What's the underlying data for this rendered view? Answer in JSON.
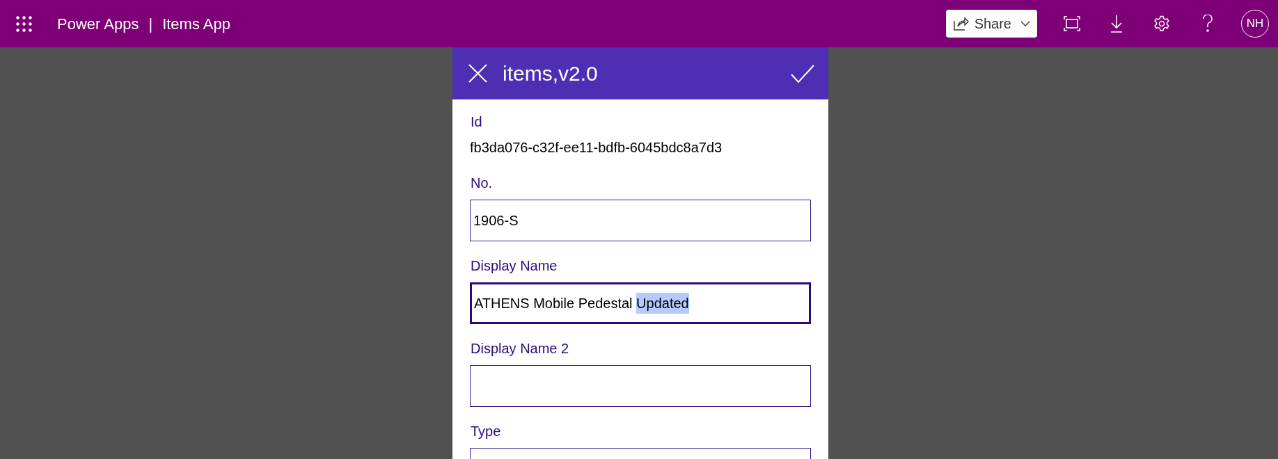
{
  "top_bar": {
    "app_name": "Power Apps",
    "separator": "|",
    "title": "Items App",
    "share_button": "Share",
    "avatar": "NH"
  },
  "form": {
    "title": "items,v2.0",
    "fields": [
      {
        "kind": "readonly",
        "label": "Id",
        "value": "fb3da076-c32f-ee11-bdfb-6045bdc8a7d3"
      },
      {
        "kind": "input",
        "label": "No.",
        "focused": false,
        "value_parts": [
          {
            "text": "1906-S",
            "selected": false
          }
        ]
      },
      {
        "kind": "input",
        "label": "Display Name",
        "focused": true,
        "value_parts": [
          {
            "text": "ATHENS Mobile Pedestal ",
            "selected": false
          },
          {
            "text": "Updated",
            "selected": true
          }
        ]
      },
      {
        "kind": "input",
        "label": "Display Name 2",
        "focused": false
      },
      {
        "kind": "input",
        "label": "Type",
        "focused": false
      }
    ]
  }
}
